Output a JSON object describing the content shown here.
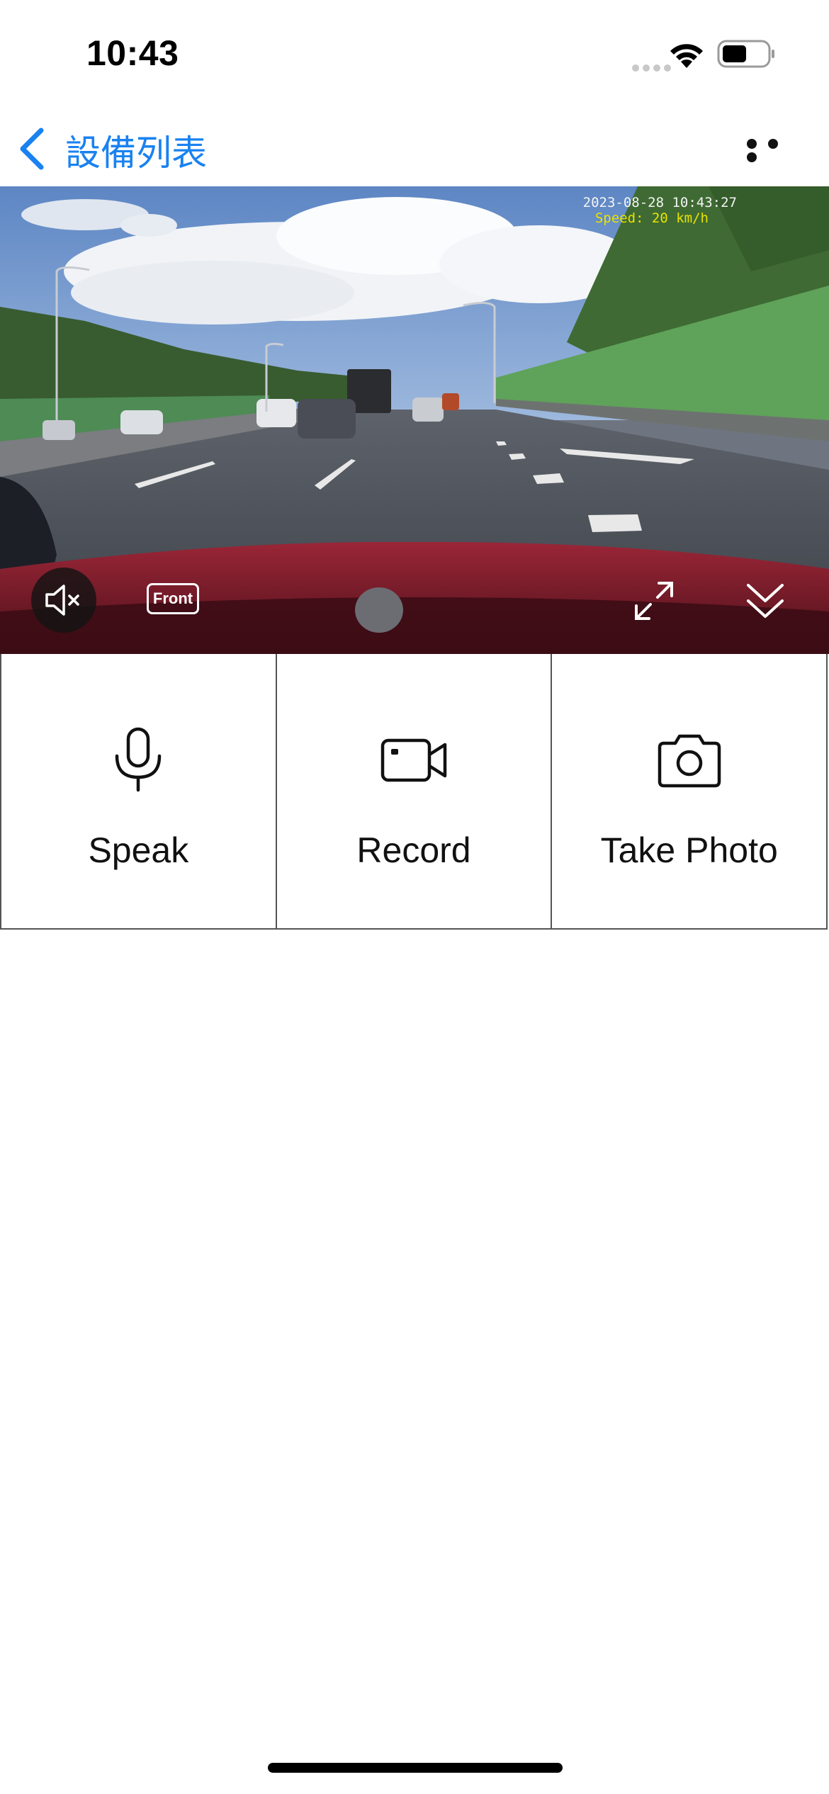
{
  "status_bar": {
    "time": "10:43",
    "battery_level": 0.55
  },
  "nav": {
    "back_label": "設備列表",
    "accent_color": "#1a82f0"
  },
  "video": {
    "overlay_date": "2023-08-28 10:43:27",
    "overlay_speed": "Speed:  20 km/h",
    "camera_label": "Front",
    "icons": [
      "mute-icon",
      "front-camera-icon",
      "expand-icon",
      "collapse-chevron-icon"
    ]
  },
  "actions": [
    {
      "label": "Speak",
      "icon": "microphone-icon"
    },
    {
      "label": "Record",
      "icon": "video-camera-icon"
    },
    {
      "label": "Take Photo",
      "icon": "camera-icon"
    }
  ]
}
